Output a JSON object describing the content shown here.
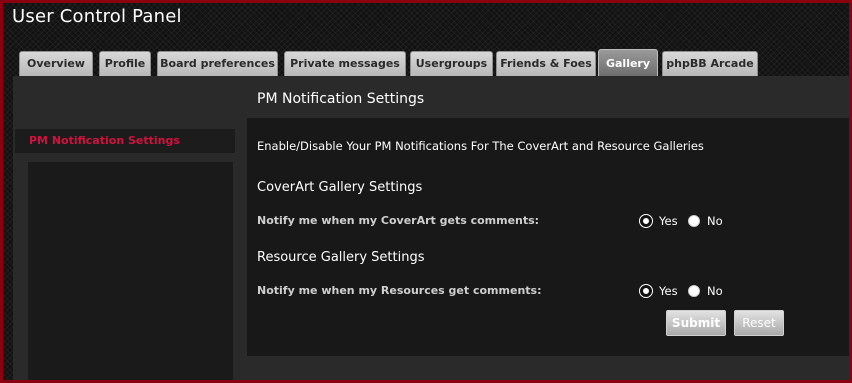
{
  "app": {
    "title": "User Control Panel"
  },
  "tabs": [
    {
      "label": "Overview"
    },
    {
      "label": "Profile"
    },
    {
      "label": "Board preferences"
    },
    {
      "label": "Private messages"
    },
    {
      "label": "Usergroups"
    },
    {
      "label": "Friends & Foes"
    },
    {
      "label": "Gallery",
      "active": true
    },
    {
      "label": "phpBB Arcade"
    }
  ],
  "sidebar": {
    "items": [
      {
        "label": "PM Notification Settings",
        "active": true
      }
    ]
  },
  "panel": {
    "heading": "PM Notification Settings",
    "intro": "Enable/Disable Your PM Notifications For The CoverArt and Resource Galleries",
    "coverart": {
      "title": "CoverArt Gallery Settings",
      "label": "Notify me when my CoverArt gets comments:",
      "yes": "Yes",
      "no": "No",
      "selected": "Yes"
    },
    "resource": {
      "title": "Resource Gallery Settings",
      "label": "Notify me when my Resources get comments:",
      "yes": "Yes",
      "no": "No",
      "selected": "Yes"
    },
    "submit_label": "Submit",
    "reset_label": "Reset"
  },
  "colors": {
    "accent": "#d2123e",
    "frame": "#8b0010"
  }
}
